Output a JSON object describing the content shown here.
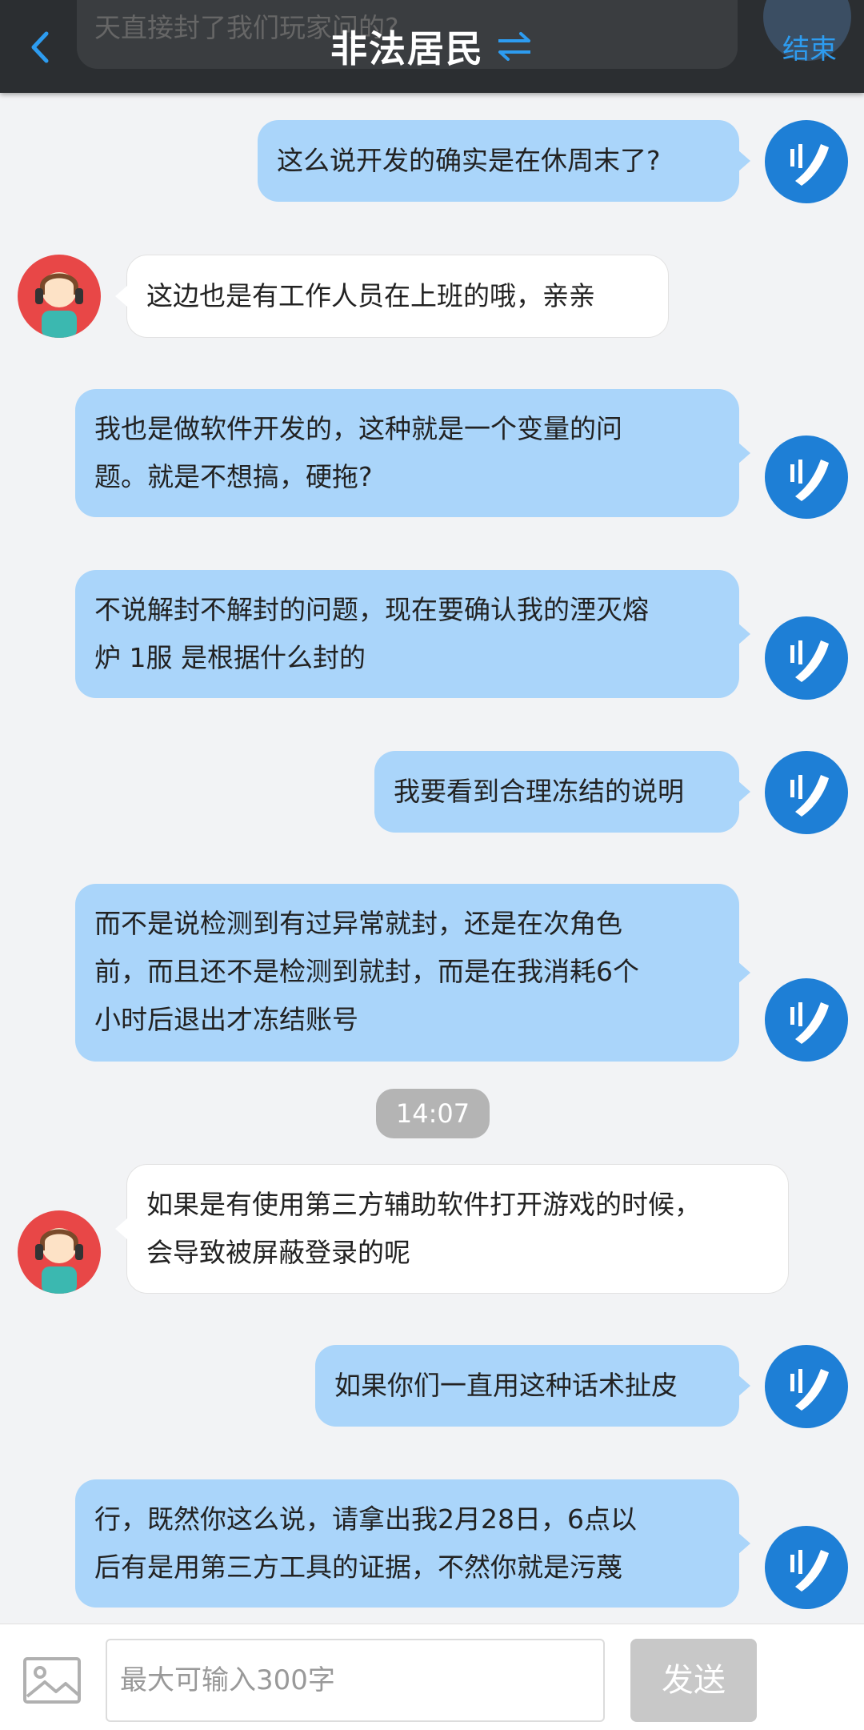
{
  "header": {
    "peek_text": "天直接封了我们玩家问的?",
    "title": "非法居民",
    "end_label": "结束"
  },
  "messages": [
    {
      "from": "me",
      "text": "这么说开发的确实是在休周末了?"
    },
    {
      "from": "agent",
      "text": "这边也是有工作人员在上班的哦，亲亲"
    },
    {
      "from": "me",
      "lines": [
        "我也是做软件开发的，这种就是一个变量的问",
        "题。就是不想搞，硬拖?"
      ]
    },
    {
      "from": "me",
      "lines": [
        "不说解封不解封的问题，现在要确认我的湮灭熔",
        "炉 1服 是根据什么封的"
      ]
    },
    {
      "from": "me",
      "text": "我要看到合理冻结的说明"
    },
    {
      "from": "me",
      "lines": [
        "而不是说检测到有过异常就封，还是在次角色",
        "前，而且还不是检测到就封，而是在我消耗6个",
        "小时后退出才冻结账号"
      ]
    },
    {
      "from": "agent",
      "lines": [
        "如果是有使用第三方辅助软件打开游戏的时候，",
        "会导致被屏蔽登录的呢"
      ]
    },
    {
      "from": "me",
      "text": "如果你们一直用这种话术扯皮"
    },
    {
      "from": "me",
      "lines": [
        "行，既然你这么说，请拿出我2月28日，6点以",
        "后有是用第三方工具的证据，不然你就是污蔑"
      ]
    }
  ],
  "timestamp": "14:07",
  "composer": {
    "placeholder": "最大可输入300字",
    "send_label": "发送"
  },
  "colors": {
    "my_bubble": "#aad5fa",
    "agent_bubble": "#ffffff",
    "accent": "#2d9cf0"
  },
  "icons": [
    "back-icon",
    "swap-icon",
    "phone-avatar-icon",
    "agent-avatar-icon",
    "image-icon"
  ]
}
